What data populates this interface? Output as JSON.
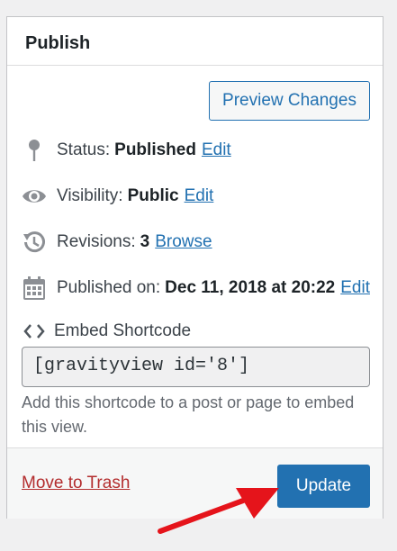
{
  "panel": {
    "title": "Publish",
    "preview_button": "Preview Changes",
    "status": {
      "label": "Status:",
      "value": "Published",
      "link": "Edit",
      "icon": "pin-icon"
    },
    "visibility": {
      "label": "Visibility:",
      "value": "Public",
      "link": "Edit",
      "icon": "eye-icon"
    },
    "revisions": {
      "label": "Revisions:",
      "value": "3",
      "link": "Browse",
      "icon": "history-icon"
    },
    "published": {
      "label": "Published on:",
      "value": "Dec 11, 2018 at 20:22",
      "link": "Edit",
      "icon": "calendar-icon"
    },
    "embed": {
      "label": "Embed Shortcode",
      "icon": "code-icon",
      "code": "[gravityview id='8']",
      "help": "Add this shortcode to a post or page to embed this view."
    },
    "footer": {
      "trash_link": "Move to Trash",
      "update_button": "Update"
    }
  },
  "colors": {
    "accent": "#2271b1",
    "danger": "#b32d2e",
    "annotation_arrow": "#e5141b"
  }
}
